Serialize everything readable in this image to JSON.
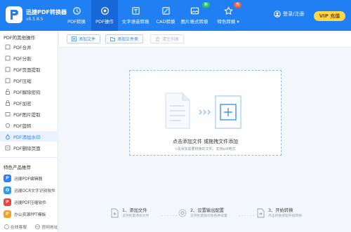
{
  "app": {
    "title": "迅捷PDF转换器",
    "version": "v8.5.8.5"
  },
  "tabs": [
    {
      "label": "PDF转换"
    },
    {
      "label": "PDF操作"
    },
    {
      "label": "文字语音转换"
    },
    {
      "label": "CAD转换"
    },
    {
      "label": "图片格式转换"
    },
    {
      "label": "特色转换"
    }
  ],
  "badges": {
    "image": "新",
    "feature": "热"
  },
  "header": {
    "login_label": "登录/注册",
    "vip_label": "VIP 充值"
  },
  "sidebar": {
    "heading": "PDF的其他操作",
    "items": [
      {
        "label": "PDF合并"
      },
      {
        "label": "PDF分割"
      },
      {
        "label": "PDF页面提取"
      },
      {
        "label": "PDF压缩"
      },
      {
        "label": "PDF解除密码"
      },
      {
        "label": "PDF加密"
      },
      {
        "label": "PDF图片提取"
      },
      {
        "label": "PDF旋转"
      },
      {
        "label": "PDF添加水印"
      },
      {
        "label": "PDF删除页面"
      }
    ],
    "recommend_heading": "特色产品推荐",
    "recommend": [
      {
        "label": "迅捷PDF编辑器",
        "color": "#2f7ff5",
        "glyph": "P"
      },
      {
        "label": "迅捷OCR文字识别软件",
        "color": "#2c9cf0",
        "glyph": "O"
      },
      {
        "label": "迅捷PDF压缩软件",
        "color": "#e8473b",
        "glyph": "P"
      },
      {
        "label": "办公资源PPT模板",
        "color": "#f0a22c",
        "glyph": "P"
      }
    ],
    "service_label": "在线客服",
    "website_label": "官网地址"
  },
  "toolbar": {
    "add_file": "添加文件",
    "add_folder": "添加文件夹",
    "clear_list": "清空列表"
  },
  "dropzone": {
    "title": "点击添加文件 或拖拽文件添加",
    "subtitle": "•请添加需要转换的文件，支持pdf格式"
  },
  "steps": [
    {
      "title": "1、添加文件",
      "desc": "支持批量添加文件"
    },
    {
      "title": "2、设置输出配置",
      "desc": "支持批量操作和各种设置"
    },
    {
      "title": "3、开始转换",
      "desc": "点击转换按钮开始转换"
    }
  ],
  "colors": {
    "brand": "#1f7ff3",
    "active_tab": "#1667d8",
    "vip": "#ffd84a"
  }
}
